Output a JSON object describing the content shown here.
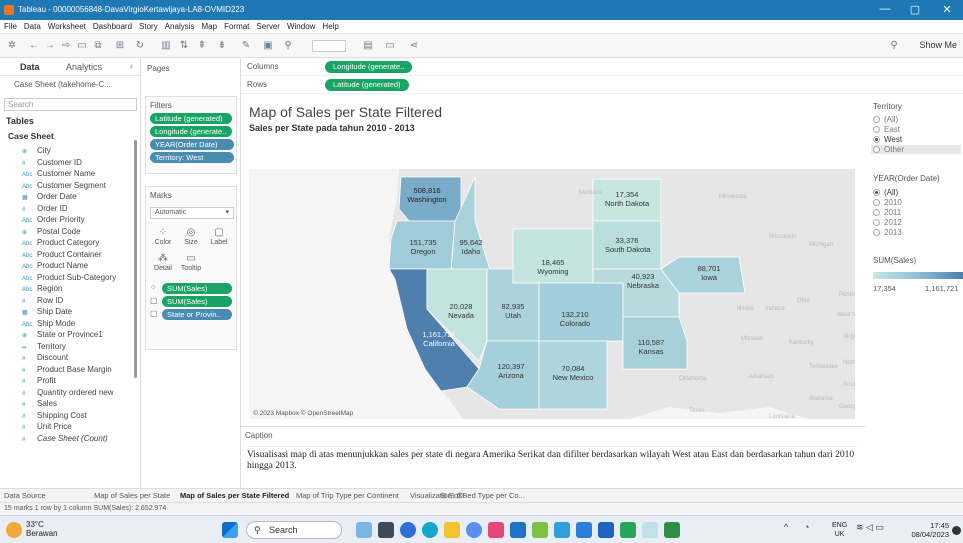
{
  "window": {
    "title": "Tableau - 00000056848-DavaVirgioKertawijaya-LA8-OVMID223"
  },
  "menu": [
    "File",
    "Data",
    "Worksheet",
    "Dashboard",
    "Story",
    "Analysis",
    "Map",
    "Format",
    "Server",
    "Window",
    "Help"
  ],
  "toolbar": {
    "show_me": "Show Me"
  },
  "left_pane": {
    "tab_data": "Data",
    "tab_analytics": "Analytics",
    "collapse": "‹",
    "data_source": "Case Sheet (takehome-C...",
    "search_placeholder": "Search",
    "tables_label": "Tables",
    "table_name": "Case Sheet",
    "fields": [
      {
        "icon": "⊕",
        "type": "g",
        "name": "City"
      },
      {
        "icon": "#",
        "type": "",
        "name": "Customer ID"
      },
      {
        "icon": "Abc",
        "type": "",
        "name": "Customer Name"
      },
      {
        "icon": "Abc",
        "type": "",
        "name": "Customer Segment"
      },
      {
        "icon": "▦",
        "type": "",
        "name": "Order Date"
      },
      {
        "icon": "#",
        "type": "",
        "name": "Order ID"
      },
      {
        "icon": "Abc",
        "type": "",
        "name": "Order Priority"
      },
      {
        "icon": "⊕",
        "type": "g",
        "name": "Postal Code"
      },
      {
        "icon": "Abc",
        "type": "",
        "name": "Product Category"
      },
      {
        "icon": "Abc",
        "type": "",
        "name": "Product Container"
      },
      {
        "icon": "Abc",
        "type": "",
        "name": "Product Name"
      },
      {
        "icon": "Abc",
        "type": "",
        "name": "Product Sub-Category"
      },
      {
        "icon": "Abc",
        "type": "",
        "name": "Region"
      },
      {
        "icon": "#",
        "type": "",
        "name": "Row ID"
      },
      {
        "icon": "▦",
        "type": "",
        "name": "Ship Date"
      },
      {
        "icon": "Abc",
        "type": "",
        "name": "Ship Mode"
      },
      {
        "icon": "⊕",
        "type": "g",
        "name": "State or Province1"
      },
      {
        "icon": "∞",
        "type": "c",
        "name": "Territory"
      },
      {
        "icon": "#",
        "type": "g",
        "name": "Discount"
      },
      {
        "icon": "#",
        "type": "g",
        "name": "Product Base Margin"
      },
      {
        "icon": "#",
        "type": "g",
        "name": "Profit"
      },
      {
        "icon": "#",
        "type": "g",
        "name": "Quantity ordered new"
      },
      {
        "icon": "#",
        "type": "g",
        "name": "Sales"
      },
      {
        "icon": "#",
        "type": "g",
        "name": "Shipping Cost"
      },
      {
        "icon": "#",
        "type": "g",
        "name": "Unit Price"
      },
      {
        "icon": "#",
        "type": "g",
        "name": "Case Sheet (Count)"
      }
    ]
  },
  "mid_pane": {
    "pages": "Pages",
    "filters": "Filters",
    "filter_pills": [
      {
        "label": "Latitude (generated)",
        "color": "g"
      },
      {
        "label": "Longitude (generate..",
        "color": "g"
      },
      {
        "label": "YEAR(Order Date)",
        "color": "b"
      },
      {
        "label": "Territory: West",
        "color": "b"
      }
    ],
    "marks": "Marks",
    "mark_type": "Automatic",
    "mark_buttons": [
      {
        "glyph": "⁘",
        "label": "Color"
      },
      {
        "glyph": "◎",
        "label": "Size"
      },
      {
        "glyph": "▢",
        "label": "Label"
      },
      {
        "glyph": "⁂",
        "label": "Detail"
      },
      {
        "glyph": "▭",
        "label": "Tooltip"
      }
    ],
    "mark_pills": [
      {
        "label": "SUM(Sales)",
        "color": "g"
      },
      {
        "label": "SUM(Sales)",
        "color": "g"
      },
      {
        "label": "State or Provin..",
        "color": "b"
      }
    ]
  },
  "shelves": {
    "columns_label": "Columns",
    "columns_pill": "Longitude (generate..",
    "rows_label": "Rows",
    "rows_pill": "Latitude (generated)"
  },
  "viz": {
    "title": "Map of Sales per State Filtered",
    "subtitle": "Sales per State pada tahun 2010 - 2013",
    "credit": "© 2023 Mapbox © OpenStreetMap",
    "bg_state_labels": [
      "Montana",
      "Minnesota",
      "Wisconsin",
      "Michigan",
      "Illinois",
      "Indiana",
      "Ohio",
      "Missouri",
      "Kentucky",
      "Tennessee",
      "Oklahoma",
      "Arkansas",
      "Alabama",
      "Georgia",
      "Texas",
      "Louisiana",
      "Pennsylvania",
      "West Virginia",
      "Virginia",
      "North Carolina",
      "South Carolina"
    ]
  },
  "chart_data": {
    "type": "map",
    "title": "Map of Sales per State Filtered",
    "subtitle": "Sales per State pada tahun 2010 - 2013",
    "measure": "SUM(Sales)",
    "regions": [
      {
        "name": "Washington",
        "value": 508816
      },
      {
        "name": "Oregon",
        "value": 151735
      },
      {
        "name": "Idaho",
        "value": 95642
      },
      {
        "name": "California",
        "value": 1161721
      },
      {
        "name": "Nevada",
        "value": 20028
      },
      {
        "name": "Utah",
        "value": 82935
      },
      {
        "name": "Arizona",
        "value": 120397
      },
      {
        "name": "Wyoming",
        "value": 18465
      },
      {
        "name": "Colorado",
        "value": 132210
      },
      {
        "name": "New Mexico",
        "value": 70084
      },
      {
        "name": "North Dakota",
        "value": 17354
      },
      {
        "name": "South Dakota",
        "value": 33376
      },
      {
        "name": "Nebraska",
        "value": 40923
      },
      {
        "name": "Kansas",
        "value": 110587
      },
      {
        "name": "Iowa",
        "value": 88701
      }
    ],
    "labels": {
      "Washington": "508,816",
      "Oregon": "151,735",
      "Idaho": "95,642",
      "California": "1,161,721",
      "Nevada": "20,028",
      "Utah": "82,935",
      "Arizona": "120,397",
      "Wyoming": "18,465",
      "Colorado": "132,210",
      "New Mexico": "70,084",
      "North Dakota": "17,354",
      "South Dakota": "33,376",
      "Nebraska": "40,923",
      "Kansas": "110,587",
      "Iowa": "88,701"
    },
    "color_range": [
      17354,
      1161721
    ],
    "colors": {
      "low": "#c8e6e0",
      "mid": "#8ebfd6",
      "high": "#4e7fad"
    }
  },
  "caption": {
    "header": "Caption",
    "text": "Visualisasi map di atas menunjukkan sales per state di negara Amerika Serikat dan difilter berdasarkan wilayah West atau East dan berdasarkan tahun dari 2010 hingga 2013."
  },
  "right_pane": {
    "territory_label": "Territory",
    "territory_options": [
      {
        "label": "(All)",
        "selected": false
      },
      {
        "label": "East",
        "selected": false
      },
      {
        "label": "West",
        "selected": true
      },
      {
        "label": "Other",
        "selected": false
      }
    ],
    "year_label": "YEAR(Order Date)",
    "year_options": [
      {
        "label": "(All)",
        "selected": true
      },
      {
        "label": "2010",
        "selected": false
      },
      {
        "label": "2011",
        "selected": false
      },
      {
        "label": "2012",
        "selected": false
      },
      {
        "label": "2013",
        "selected": false
      }
    ],
    "legend_label": "SUM(Sales)",
    "legend_min": "17,354",
    "legend_max": "1,161,721"
  },
  "sheet_tabs": [
    {
      "label": "Data Source",
      "active": false
    },
    {
      "label": "Map of Sales per State",
      "active": false
    },
    {
      "label": "Map of Sales per State Filtered",
      "active": true
    },
    {
      "label": "Map of Trip Type per Continent",
      "active": false
    },
    {
      "label": "Visualization of Bed Type per Co...",
      "active": false
    }
  ],
  "status": "15 marks   1 row by 1 column   SUM(Sales): 2.652.974",
  "taskbar": {
    "weather_temp": "33°C",
    "weather_desc": "Berawan",
    "search": "Search",
    "lang1": "ENG",
    "lang2": "UK",
    "time": "17:45",
    "date": "08/04/2023"
  }
}
